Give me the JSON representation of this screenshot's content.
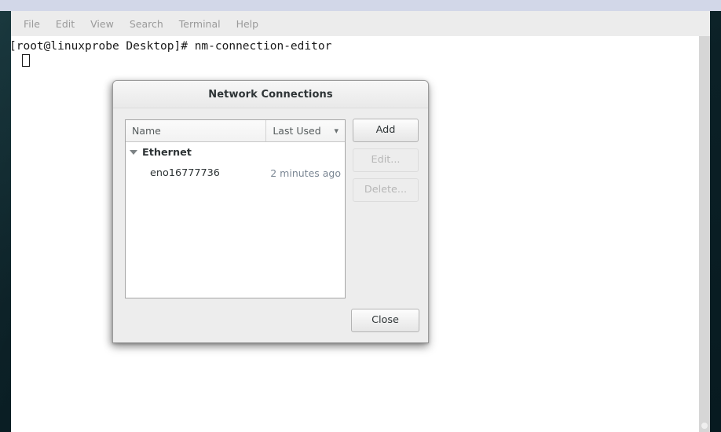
{
  "desktop": {
    "background_color": "#0d2428",
    "top_strip_color": "#d2d7e8"
  },
  "terminal": {
    "menu": [
      {
        "label": "File"
      },
      {
        "label": "Edit"
      },
      {
        "label": "View"
      },
      {
        "label": "Search"
      },
      {
        "label": "Terminal"
      },
      {
        "label": "Help"
      }
    ],
    "prompt_line": "[root@linuxprobe Desktop]# nm-connection-editor",
    "cursor": "block-outline-cursor"
  },
  "dialog": {
    "title": "Network Connections",
    "list": {
      "columns": [
        {
          "label": "Name"
        },
        {
          "label": "Last Used",
          "sort_icon": "chevron-down-icon"
        }
      ],
      "groups": [
        {
          "label": "Ethernet",
          "expanded": true,
          "expander_icon": "triangle-down-icon",
          "rows": [
            {
              "name": "eno16777736",
              "last_used": "2 minutes ago"
            }
          ]
        }
      ]
    },
    "side_buttons": [
      {
        "label": "Add",
        "enabled": true
      },
      {
        "label": "Edit...",
        "enabled": false
      },
      {
        "label": "Delete...",
        "enabled": false
      }
    ],
    "close_button": {
      "label": "Close"
    }
  }
}
